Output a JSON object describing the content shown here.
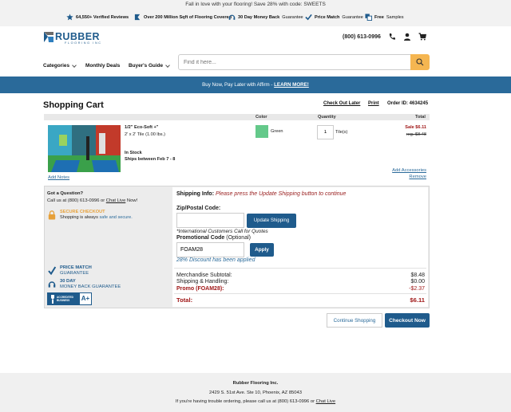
{
  "promo_bar": {
    "text": "Fall in love with your flooring! Save 28% with code: SWEETS"
  },
  "trust_bar": {
    "items": [
      {
        "icon": "star-icon",
        "bold": "64,550+ Verified Reviews",
        "text": ""
      },
      {
        "icon": "flag-icon",
        "bold": "Over 200 Million Sqft of Flooring Covered",
        "text": ""
      },
      {
        "icon": "headset-icon",
        "bold": "30 Day Money Back",
        "text": "Guarantee"
      },
      {
        "icon": "checkmark-icon",
        "bold": "Price Match",
        "text": "Guarantee"
      },
      {
        "icon": "samples-icon",
        "bold": "Free",
        "text": "Samples"
      }
    ]
  },
  "header": {
    "logo_main": "RUBBER",
    "logo_sub": "FLOORING INC",
    "phone": "(800) 613-0996",
    "icons": [
      "phone-icon",
      "account-icon",
      "cart-icon"
    ]
  },
  "nav": {
    "items": [
      "Categories",
      "Monthly Deals",
      "Buyer's Guide"
    ],
    "search_placeholder": "Find it here..."
  },
  "affirm_bar": {
    "text": "Buy Now, Pay Later with Affirm - ",
    "link": "LEARN MORE!"
  },
  "cart": {
    "title": "Shopping Cart",
    "checkout_later": "Check Out Later",
    "print": "Print",
    "order_id": "Order ID: 4634245",
    "columns": [
      "Color",
      "Quantity",
      "Total"
    ],
    "item": {
      "name": "1/2\" Eco-Soft +\"",
      "size": "2' x 2' Tile (1.00 lbs.)",
      "stock": "In Stock",
      "ships": "Ships between Feb 7 - 8",
      "color_name": "Green",
      "color_hex": "#64c98a",
      "quantity": "1",
      "unit": "Tile(s)",
      "sale_price": "Sale $6.11",
      "reg_price": "reg. $8.48",
      "add_accessories": "Add Accessories",
      "remove": "Remove"
    },
    "add_notes": "Add Notes"
  },
  "sidebar": {
    "question": "Got a Question?",
    "call_text": "Call us at (800) 613-0996 or ",
    "chat_live": "Chat Live",
    "call_suffix": " Now!",
    "secure_title": "SECURE CHECKOUT",
    "secure_text": "Shopping is always ",
    "secure_link": "safe and secure.",
    "price_match_1": "PRICE MATCH",
    "price_match_2": "GUARANTEE",
    "money_back_1": "30 DAY",
    "money_back_2": "MONEY BACK GUARANTEE",
    "bbb_text": "ACCREDITED BUSINESS",
    "bbb_rating": "A+"
  },
  "shipping": {
    "label": "Shipping Info:",
    "message": "Please press the Update Shipping button to continue",
    "zip_label": "Zip/Postal Code:",
    "zip_value": "",
    "update_button": "Update Shipping",
    "intl_note": "*International Customers Call for Quotes",
    "promo_label": "Promotional Code",
    "promo_optional": "(Optional)",
    "promo_value": "FOAM28",
    "apply_button": "Apply",
    "discount_note": "28% Discount has been applied"
  },
  "summary": {
    "merch_label": "Merchandise Subtotal:",
    "merch_value": "$8.48",
    "ship_label": "Shipping & Handling:",
    "ship_value": "$0.00",
    "promo_label": "Promo (FOAM28):",
    "promo_value": "-$2.37",
    "total_label": "Total:",
    "total_value": "$6.11"
  },
  "actions": {
    "continue": "Continue Shopping",
    "checkout": "Checkout Now"
  },
  "footer": {
    "company": "Rubber Flooring Inc.",
    "address": "2429 S. 51st Ave. Ste 10, Phoenix, AZ 85043",
    "help_text": "If you're having trouble ordering, please call us at (800) 613-0996 or ",
    "help_link": "Chat Live"
  },
  "colors": {
    "brand_blue": "#1f5b8c",
    "affirm_bar": "#2a6a9a",
    "sale_red": "#a01818",
    "search_button": "#f5b651",
    "secure_orange": "#e6a03a"
  }
}
